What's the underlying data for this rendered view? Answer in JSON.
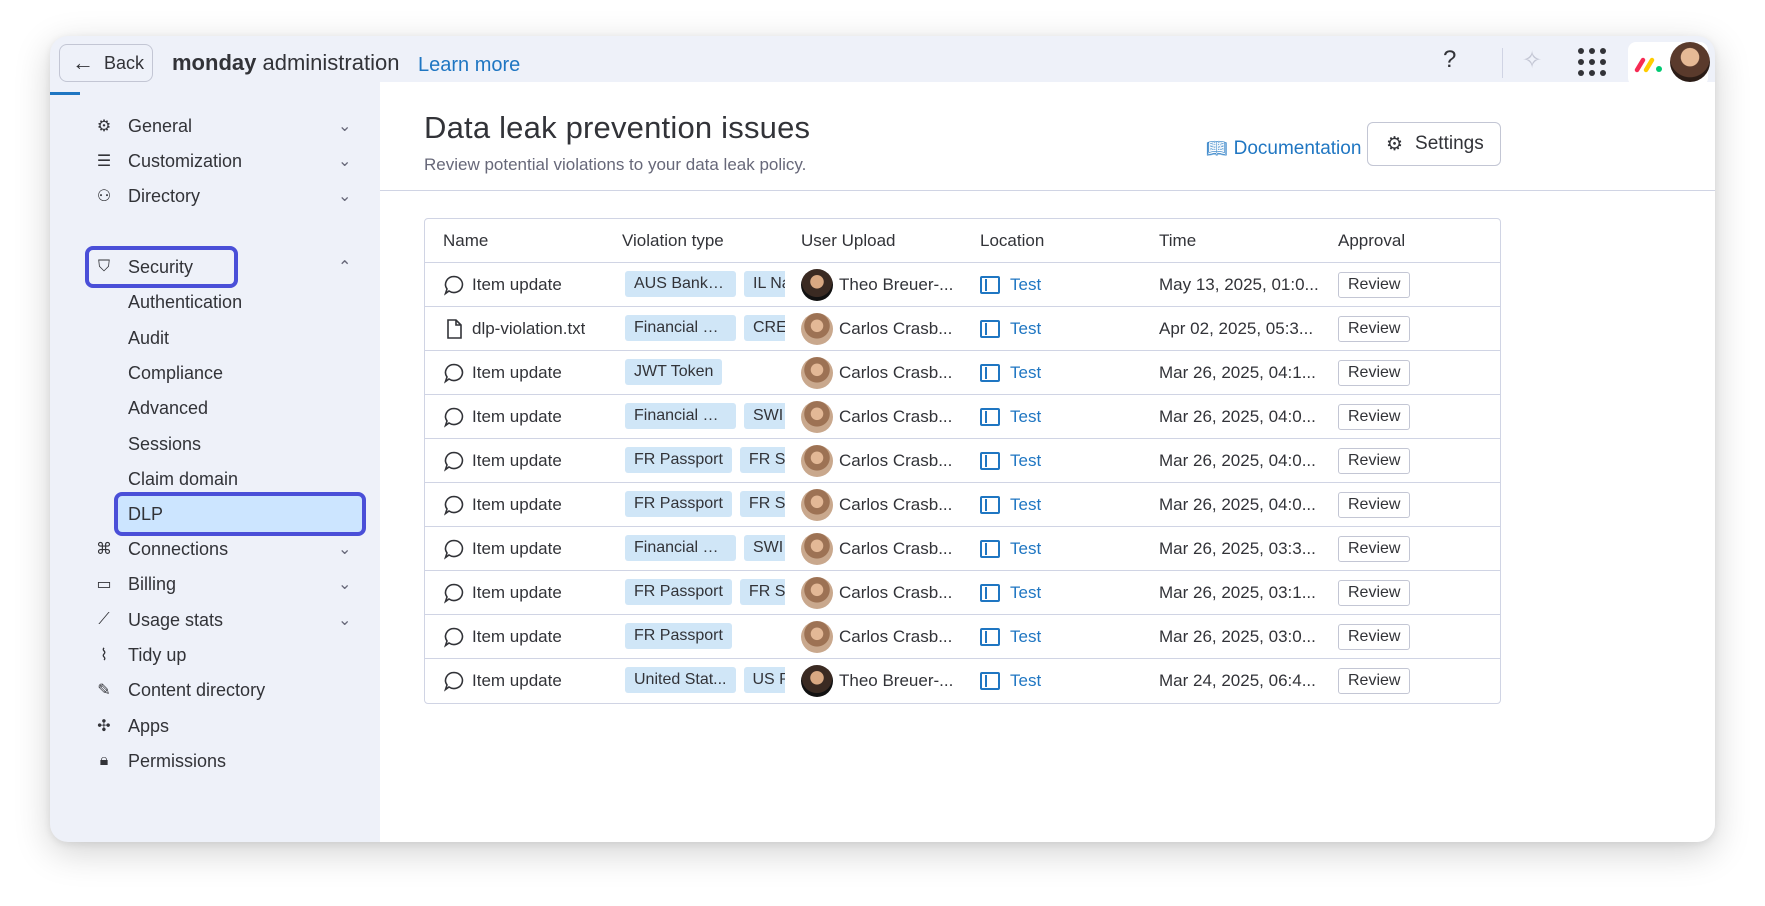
{
  "topbar": {
    "back_label": "Back",
    "app_title_bold": "monday",
    "app_title_rest": " administration",
    "learn_more": "Learn more",
    "help": "?"
  },
  "sidebar": {
    "items": [
      {
        "label": "General",
        "icon": "gear-icon",
        "expandable": true
      },
      {
        "label": "Customization",
        "icon": "sliders-icon",
        "expandable": true
      },
      {
        "label": "Directory",
        "icon": "people-icon",
        "expandable": true
      },
      {
        "label": "Security",
        "icon": "shield-icon",
        "expandable": true,
        "expanded": true
      },
      {
        "label": "Connections",
        "icon": "connections-icon",
        "expandable": true
      },
      {
        "label": "Billing",
        "icon": "card-icon",
        "expandable": true
      },
      {
        "label": "Usage stats",
        "icon": "chart-icon",
        "expandable": true
      },
      {
        "label": "Tidy up",
        "icon": "broom-icon",
        "expandable": false
      },
      {
        "label": "Content directory",
        "icon": "content-icon",
        "expandable": false
      },
      {
        "label": "Apps",
        "icon": "puzzle-icon",
        "expandable": false
      },
      {
        "label": "Permissions",
        "icon": "lock-icon",
        "expandable": false
      }
    ],
    "security_sub": [
      "Authentication",
      "Audit",
      "Compliance",
      "Advanced",
      "Sessions",
      "Claim domain",
      "DLP"
    ],
    "selected": "DLP"
  },
  "main": {
    "title": "Data leak prevention issues",
    "subtitle": "Review potential violations to your data leak policy.",
    "documentation": "Documentation",
    "settings": "Settings",
    "columns": [
      "Name",
      "Violation type",
      "User Upload",
      "Location",
      "Time",
      "Approval"
    ],
    "rows": [
      {
        "icon": "comment-icon",
        "name": "Item update",
        "tags": [
          "AUS Bank A...",
          "IL Na"
        ],
        "user": "Theo Breuer-...",
        "avatar": "theo",
        "location": "Test",
        "time": "May 13, 2025, 01:0...",
        "approval": "Review"
      },
      {
        "icon": "file-icon",
        "name": "dlp-violation.txt",
        "tags": [
          "Financial De...",
          "CRE"
        ],
        "user": "Carlos Crasb...",
        "avatar": "carlos",
        "location": "Test",
        "time": "Apr 02, 2025, 05:3...",
        "approval": "Review"
      },
      {
        "icon": "comment-icon",
        "name": "Item update",
        "tags": [
          "JWT Token"
        ],
        "user": "Carlos Crasb...",
        "avatar": "carlos",
        "location": "Test",
        "time": "Mar 26, 2025, 04:1...",
        "approval": "Review"
      },
      {
        "icon": "comment-icon",
        "name": "Item update",
        "tags": [
          "Financial De...",
          "SWI"
        ],
        "user": "Carlos Crasb...",
        "avatar": "carlos",
        "location": "Test",
        "time": "Mar 26, 2025, 04:0...",
        "approval": "Review"
      },
      {
        "icon": "comment-icon",
        "name": "Item update",
        "tags": [
          "FR Passport",
          "FR SS"
        ],
        "user": "Carlos Crasb...",
        "avatar": "carlos",
        "location": "Test",
        "time": "Mar 26, 2025, 04:0...",
        "approval": "Review"
      },
      {
        "icon": "comment-icon",
        "name": "Item update",
        "tags": [
          "FR Passport",
          "FR SS"
        ],
        "user": "Carlos Crasb...",
        "avatar": "carlos",
        "location": "Test",
        "time": "Mar 26, 2025, 04:0...",
        "approval": "Review"
      },
      {
        "icon": "comment-icon",
        "name": "Item update",
        "tags": [
          "Financial De...",
          "SWI"
        ],
        "user": "Carlos Crasb...",
        "avatar": "carlos",
        "location": "Test",
        "time": "Mar 26, 2025, 03:3...",
        "approval": "Review"
      },
      {
        "icon": "comment-icon",
        "name": "Item update",
        "tags": [
          "FR Passport",
          "FR SS"
        ],
        "user": "Carlos Crasb...",
        "avatar": "carlos",
        "location": "Test",
        "time": "Mar 26, 2025, 03:1...",
        "approval": "Review"
      },
      {
        "icon": "comment-icon",
        "name": "Item update",
        "tags": [
          "FR Passport"
        ],
        "user": "Carlos Crasb...",
        "avatar": "carlos",
        "location": "Test",
        "time": "Mar 26, 2025, 03:0...",
        "approval": "Review"
      },
      {
        "icon": "comment-icon",
        "name": "Item update",
        "tags": [
          "United Stat...",
          "US P"
        ],
        "user": "Theo Breuer-...",
        "avatar": "theo",
        "location": "Test",
        "time": "Mar 24, 2025, 06:4...",
        "approval": "Review"
      }
    ]
  },
  "colors": {
    "accent": "#1f76c2",
    "highlight_border": "#4a4fd8",
    "selected_bg": "#cce5ff",
    "tag_bg": "#d0e6f7"
  }
}
